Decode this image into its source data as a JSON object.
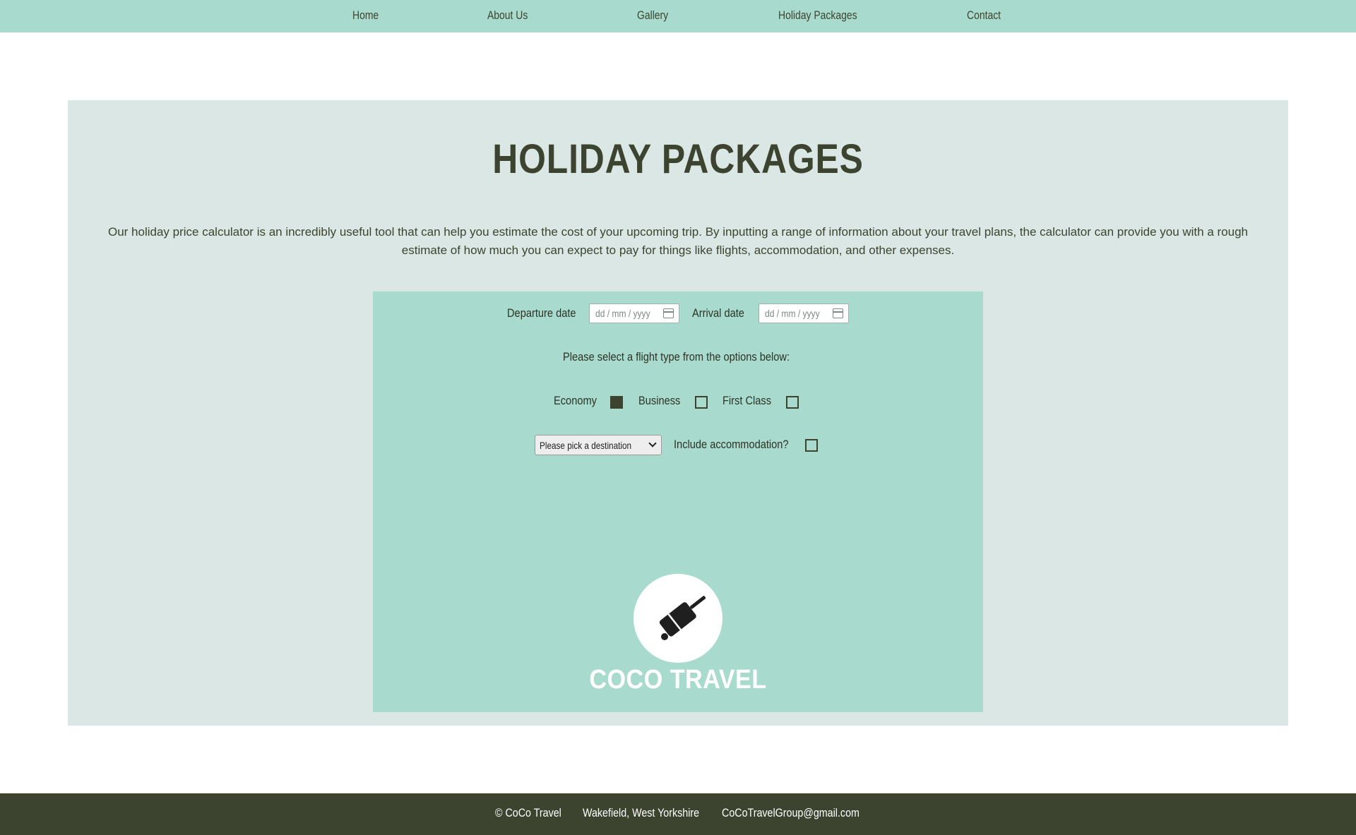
{
  "nav": {
    "items": [
      {
        "label": "Home"
      },
      {
        "label": "About Us"
      },
      {
        "label": "Gallery"
      },
      {
        "label": "Holiday Packages"
      },
      {
        "label": "Contact"
      }
    ]
  },
  "page": {
    "title": "HOLIDAY PACKAGES",
    "intro": "Our holiday price calculator is an incredibly useful tool that can help you estimate the cost of your upcoming trip. By inputting a range of information about your travel plans, the calculator can provide you with a rough estimate of how much you can expect to pay for things like flights, accommodation, and other expenses."
  },
  "form": {
    "departure_label": "Departure date",
    "departure_placeholder": "dd / mm / yyyy",
    "arrival_label": "Arrival date",
    "arrival_placeholder": "dd / mm / yyyy",
    "flight_prompt": "Please select a flight type from the options below:",
    "flight_types": [
      {
        "label": "Economy",
        "checked": true
      },
      {
        "label": "Business",
        "checked": false
      },
      {
        "label": "First Class",
        "checked": false
      }
    ],
    "destination_select": "Please pick a destination",
    "accommodation_label": "Include accommodation?",
    "accommodation_checked": false
  },
  "logo": {
    "text": "COCO TRAVEL",
    "icon": "suitcase-icon"
  },
  "footer": {
    "copyright": "© CoCo Travel",
    "location": "Wakefield, West Yorkshire",
    "email": "CoCoTravelGroup@gmail.com"
  },
  "colors": {
    "nav_bg": "#a8dbce",
    "panel_bg": "#dbe7e4",
    "form_bg": "#a8dbce",
    "text_dark": "#3c4430",
    "footer_bg": "#3c4430"
  }
}
